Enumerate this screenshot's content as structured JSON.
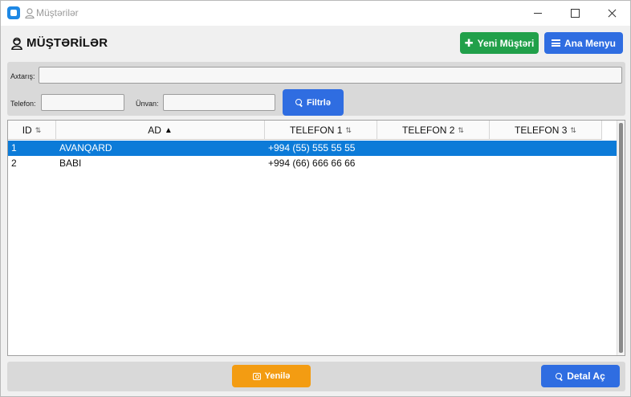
{
  "window": {
    "title": "Müştərilər"
  },
  "header": {
    "title": "MÜŞTƏRİLƏR",
    "new_button": "Yeni Müştəri",
    "menu_button": "Ana Menyu"
  },
  "filters": {
    "search_label": "Axtarış:",
    "search_value": "",
    "phone_label": "Telefon:",
    "phone_value": "",
    "address_label": "Ünvan:",
    "address_value": "",
    "filter_button": "Filtrlə"
  },
  "table": {
    "columns": [
      "ID",
      "AD",
      "TELEFON 1",
      "TELEFON 2",
      "TELEFON 3"
    ],
    "sort_glyph": "⇅",
    "active_sort_glyph": "▲",
    "rows": [
      {
        "id": "1",
        "ad": "AVANQARD",
        "telefon1": "+994 (55) 555 55 55",
        "telefon2": "",
        "telefon3": "",
        "selected": true
      },
      {
        "id": "2",
        "ad": "BABI",
        "telefon1": "+994 (66) 666 66 66",
        "telefon2": "",
        "telefon3": "",
        "selected": false
      }
    ]
  },
  "footer": {
    "refresh_button": "Yenilə",
    "detail_button": "Detal Aç"
  },
  "colors": {
    "green": "#21a04a",
    "blue": "#2f6de1",
    "orange": "#f39c12",
    "selection": "#0c7bd8"
  }
}
